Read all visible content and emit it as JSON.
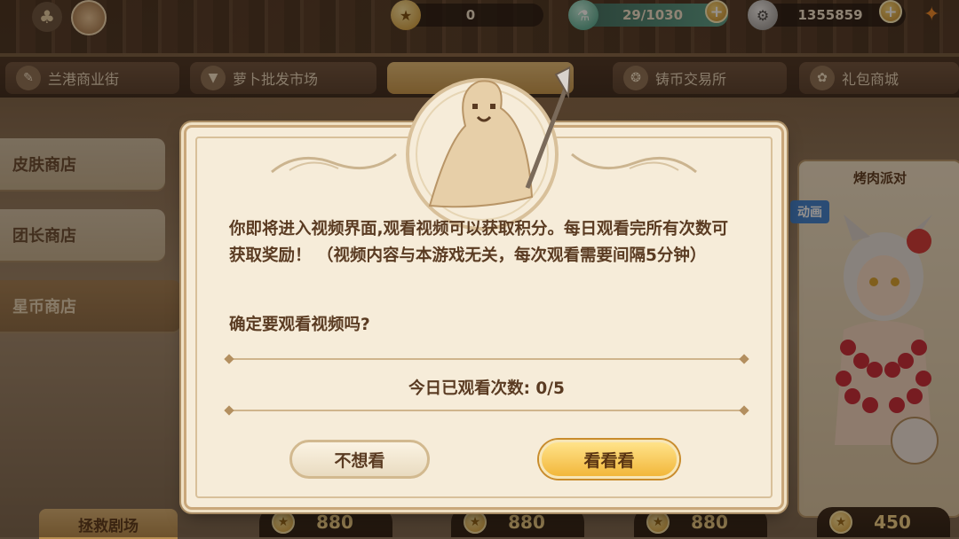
{
  "top_bar": {
    "currency_1": "0",
    "stamina": "29/1030",
    "currency_2": "1355859"
  },
  "tabs": [
    {
      "label": "兰港商业街"
    },
    {
      "label": "萝卜批发市场"
    },
    {
      "label": "铸币交易所"
    },
    {
      "label": "礼包商城"
    }
  ],
  "side_menu": [
    {
      "label": "皮肤商店"
    },
    {
      "label": "团长商店"
    },
    {
      "label": "星币商店"
    }
  ],
  "card": {
    "title": "烤肉派对",
    "badge": "动画"
  },
  "prices": [
    "880",
    "880",
    "880",
    "450"
  ],
  "bottom_left_button": "拯救剧场",
  "dialog": {
    "message": "你即将进入视频界面,观看视频可以获取积分。每日观看完所有次数可获取奖励！ （视频内容与本游戏无关，每次观看需要间隔5分钟）",
    "confirm_question": "确定要观看视频吗?",
    "watch_count": "今日已观看次数: 0/5",
    "cancel_label": "不想看",
    "ok_label": "看看看"
  },
  "colors": {
    "dialog_bg": "#f6ecd9",
    "text_brown": "#5a3b22",
    "ok_button": "#f2b73b",
    "badge_blue": "#3c82d1"
  }
}
